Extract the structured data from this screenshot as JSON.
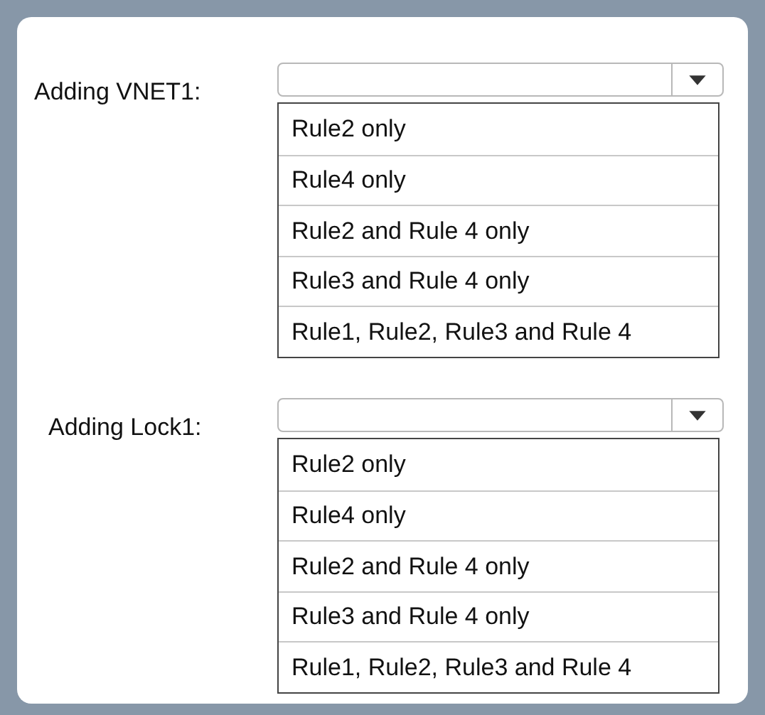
{
  "questions": [
    {
      "label": "Adding VNET1:",
      "options": [
        {
          "text": "Rule2 only"
        },
        {
          "text": "Rule4 only"
        },
        {
          "text": "Rule2 and Rule 4 only"
        },
        {
          "text": "Rule3 and Rule 4 only"
        },
        {
          "text": "Rule1, Rule2, Rule3 and Rule 4"
        }
      ]
    },
    {
      "label": "Adding Lock1:",
      "options": [
        {
          "text": "Rule2 only"
        },
        {
          "text": "Rule4 only"
        },
        {
          "text": "Rule2 and Rule 4 only"
        },
        {
          "text": "Rule3 and Rule 4 only"
        },
        {
          "text": "Rule1, Rule2, Rule3 and Rule 4"
        }
      ]
    }
  ]
}
